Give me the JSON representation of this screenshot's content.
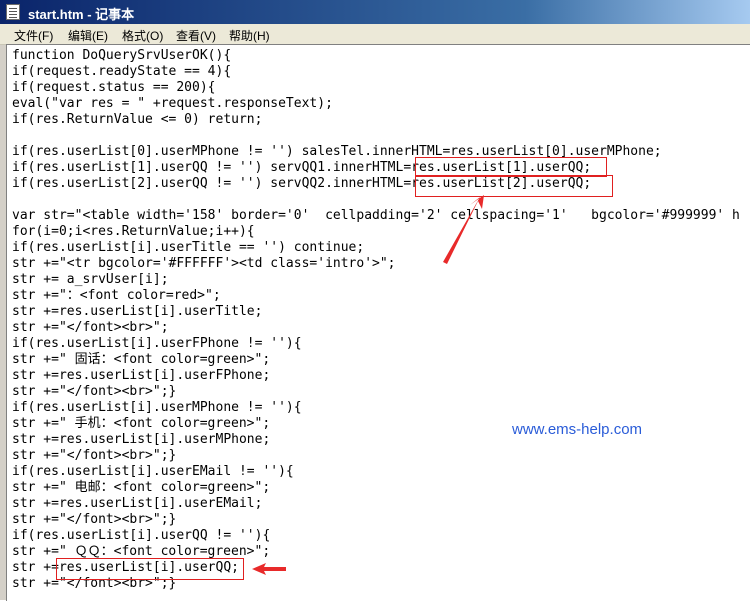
{
  "window": {
    "title": "start.htm - 记事本",
    "icon": "notepad-icon"
  },
  "menu": [
    {
      "label": "文件(F)"
    },
    {
      "label": "编辑(E)"
    },
    {
      "label": "格式(O)"
    },
    {
      "label": "查看(V)"
    },
    {
      "label": "帮助(H)"
    }
  ],
  "editor": {
    "lines": [
      "function DoQuerySrvUserOK(){",
      "if(request.readyState == 4){",
      "if(request.status == 200){",
      "eval(\"var res = \" +request.responseText);",
      "if(res.ReturnValue <= 0) return;",
      "",
      "if(res.userList[0].userMPhone != '') salesTel.innerHTML=res.userList[0].userMPhone;",
      "if(res.userList[1].userQQ != '') servQQ1.innerHTML=res.userList[1].userQQ;",
      "if(res.userList[2].userQQ != '') servQQ2.innerHTML=res.userList[2].userQQ;",
      "",
      "var str=\"<table width='158' border='0'  cellpadding='2' cellspacing='1'   bgcolor='#999999' h",
      "for(i=0;i<res.ReturnValue;i++){",
      "if(res.userList[i].userTitle == '') continue;",
      "str +=\"<tr bgcolor='#FFFFFF'><td class='intro'>\";",
      "str += a_srvUser[i];",
      "str +=\"：<font color=red>\";",
      "str +=res.userList[i].userTitle;",
      "str +=\"</font><br>\";",
      "if(res.userList[i].userFPhone != ''){",
      "str +=\" 固话：<font color=green>\";",
      "str +=res.userList[i].userFPhone;",
      "str +=\"</font><br>\";}",
      "if(res.userList[i].userMPhone != ''){",
      "str +=\" 手机：<font color=green>\";",
      "str +=res.userList[i].userMPhone;",
      "str +=\"</font><br>\";}",
      "if(res.userList[i].userEMail != ''){",
      "str +=\" 电邮：<font color=green>\";",
      "str +=res.userList[i].userEMail;",
      "str +=\"</font><br>\";}",
      "if(res.userList[i].userQQ != ''){",
      "str +=\" ＱＱ：<font color=green>\";",
      "str +=res.userList[i].userQQ;",
      "str +=\"</font><br>\";}"
    ]
  },
  "annotations": {
    "watermark": "www.ems-help.com",
    "highlight_color": "#e02020"
  }
}
